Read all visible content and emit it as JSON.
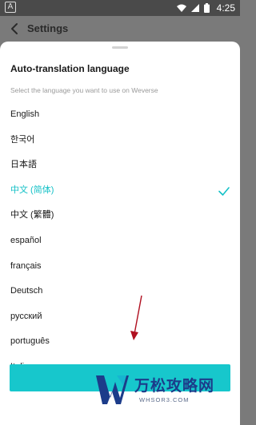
{
  "status_bar": {
    "time": "4:25",
    "app_icon": "A"
  },
  "header": {
    "title": "Settings"
  },
  "sheet": {
    "title": "Auto-translation language",
    "subtitle": "Select the language you want to use on Weverse",
    "languages": [
      {
        "label": "English",
        "selected": false
      },
      {
        "label": "한국어",
        "selected": false
      },
      {
        "label": "日本語",
        "selected": false
      },
      {
        "label": "中文 (简体)",
        "selected": true
      },
      {
        "label": "中文 (繁體)",
        "selected": false
      },
      {
        "label": "español",
        "selected": false
      },
      {
        "label": "français",
        "selected": false
      },
      {
        "label": "Deutsch",
        "selected": false
      },
      {
        "label": "русский",
        "selected": false
      },
      {
        "label": "português",
        "selected": false
      },
      {
        "label": "Italiano",
        "selected": false
      }
    ],
    "confirm_label": ""
  },
  "watermark": {
    "text": "万松攻略网",
    "url": "WHSOR3.COM"
  },
  "colors": {
    "accent": "#15c1c7",
    "annotation": "#b01020"
  }
}
